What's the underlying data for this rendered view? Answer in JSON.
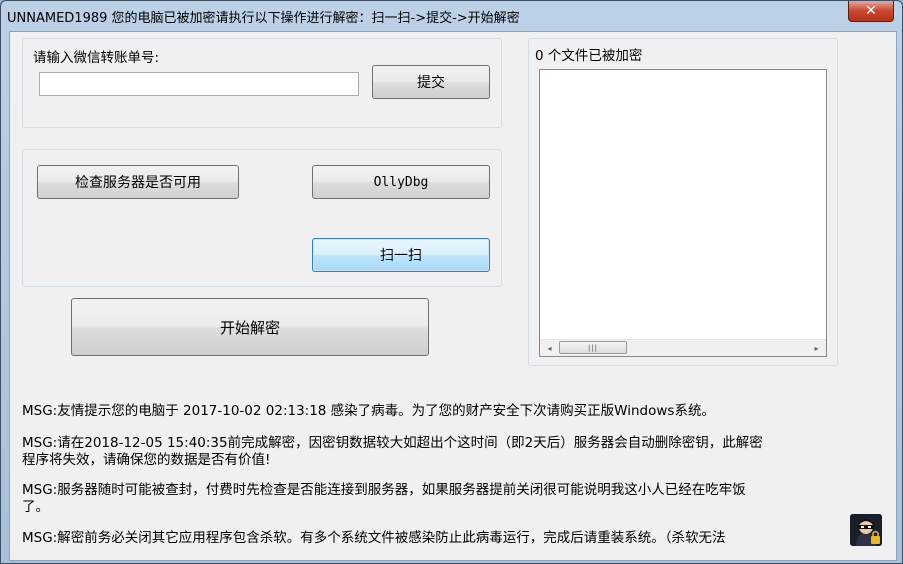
{
  "window": {
    "title": "UNNAMED1989  您的电脑已被加密请执行以下操作进行解密：扫一扫->提交->开始解密",
    "close_glyph": "✕"
  },
  "transfer": {
    "label": "请输入微信转账单号:",
    "input_value": "",
    "submit_label": "提交"
  },
  "tools": {
    "check_server_label": "检查服务器是否可用",
    "ollydbg_label": "OllyDbg",
    "scan_label": "扫一扫"
  },
  "decrypt_label": "开始解密",
  "files": {
    "header": "0 个文件已被加密",
    "scroll_left": "◂",
    "scroll_right": "▸",
    "thumb_grip": "|||"
  },
  "messages": [
    "MSG:友情提示您的电脑于 2017-10-02 02:13:18  感染了病毒。为了您的财产安全下次请购买正版Windows系统。",
    "MSG:请在2018-12-05 15:40:35前完成解密，因密钥数据较大如超出个这时间（即2天后）服务器会自动删除密钥，此解密",
    "程序将失效，请确保您的数据是否有价值!",
    "MSG:服务器随时可能被查封，付费时先检查是否能连接到服务器，如果服务器提前关闭很可能说明我这小人已经在吃牢饭",
    "了。",
    "MSG:解密前务必关闭其它应用程序包含杀软。有多个系统文件被感染防止此病毒运行，完成后请重装系统。（杀软无法"
  ],
  "icons": {
    "close": "close-icon",
    "avatar": "hacker-avatar-icon"
  }
}
